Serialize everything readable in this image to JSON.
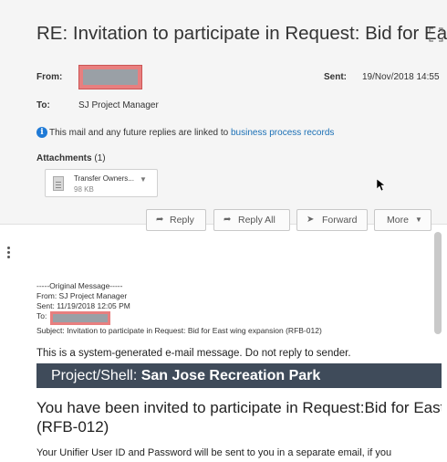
{
  "title": "RE: Invitation to participate in Request: Bid for Ea...",
  "from_label": "From:",
  "to_label": "To:",
  "to_value": "SJ Project Manager",
  "sent_label": "Sent:",
  "sent_value": "19/Nov/2018 14:55",
  "info": {
    "text": "This mail and any future replies are linked to",
    "link": "business process records"
  },
  "attachments": {
    "label": "Attachments",
    "count": "(1)",
    "file_name": "Transfer Owners...",
    "file_size": "98 KB"
  },
  "buttons": {
    "reply": "Reply",
    "reply_all": "Reply All",
    "forward": "Forward",
    "more": "More"
  },
  "original": {
    "header": "-----Original Message-----",
    "from": "From: SJ Project Manager",
    "sent": "Sent: 11/19/2018 12:05 PM",
    "to": "To:",
    "subject": "Subject: Invitation to participate in Request: Bid for East wing expansion (RFB-012)"
  },
  "body": {
    "system_msg": "This is a system-generated e-mail message. Do not reply to sender.",
    "banner_label": "Project/Shell:",
    "banner_value": "San Jose Recreation Park",
    "invite_line1": "You have been invited to participate in Request:Bid for East wing expansion",
    "invite_line2": "(RFB-012)",
    "unifier_line": "Your Unifier User ID and Password will be sent to you in a separate email, if you"
  },
  "colors": {
    "header_bg": "#f5f5f5",
    "banner_bg": "#3f4b5a",
    "link": "#1a6fb5",
    "redaction": "#e87f7f"
  }
}
